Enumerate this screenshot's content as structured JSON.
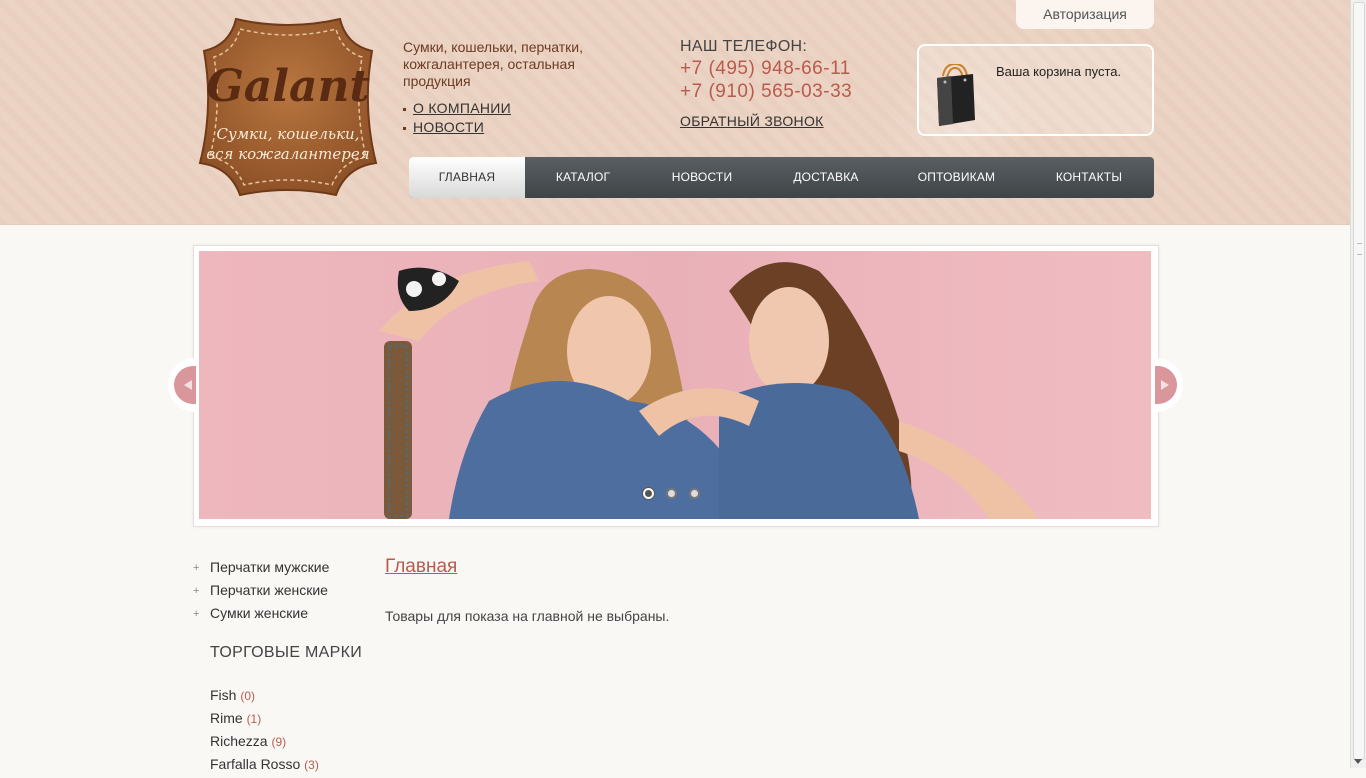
{
  "header": {
    "logo_brand": "Galant",
    "logo_tagline": "Сумки, кошельки, вся кожгалантерея",
    "tagline": "Сумки, кошельки, перчатки, кожгалантерея, остальная продукция",
    "topnav": [
      {
        "label": "О КОМПАНИИ"
      },
      {
        "label": "НОВОСТИ"
      }
    ],
    "phone_title": "НАШ ТЕЛЕФОН:",
    "phones": [
      "+7 (495) 948-66-11",
      "+7 (910) 565-03-33"
    ],
    "callback": "ОБРАТНЫЙ ЗВОНОК",
    "auth": "Авторизация",
    "cart_text": "Ваша корзина пуста.",
    "accent_color": "#b95a4e"
  },
  "nav": {
    "items": [
      {
        "label": "ГЛАВНАЯ",
        "active": true
      },
      {
        "label": "КАТАЛОГ"
      },
      {
        "label": "НОВОСТИ"
      },
      {
        "label": "ДОСТАВКА"
      },
      {
        "label": "ОПТОВИКАМ"
      },
      {
        "label": "КОНТАКТЫ"
      }
    ]
  },
  "slider": {
    "slide_count": 3,
    "active_index": 0
  },
  "sidebar": {
    "categories": [
      {
        "label": "Перчатки мужские"
      },
      {
        "label": "Перчатки женские"
      },
      {
        "label": "Сумки женские"
      }
    ],
    "brands_title": "ТОРГОВЫЕ МАРКИ",
    "brands": [
      {
        "name": "Fish",
        "count": "(0)"
      },
      {
        "name": "Rime",
        "count": "(1)"
      },
      {
        "name": "Richezza",
        "count": "(9)"
      },
      {
        "name": "Farfalla Rosso",
        "count": "(3)"
      }
    ]
  },
  "main": {
    "title": "Главная",
    "text": "Товары для показа на главной не выбраны."
  }
}
